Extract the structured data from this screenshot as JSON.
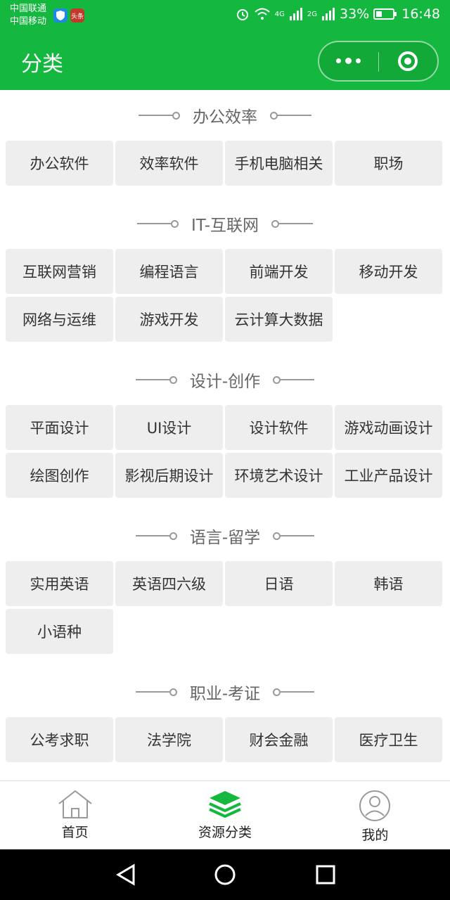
{
  "status_bar": {
    "carrier_1": "中国联通",
    "carrier_2": "中国移动",
    "app_badge": "头条",
    "network_1": "4G",
    "network_2": "2G",
    "battery": "33%",
    "time": "16:48"
  },
  "title_bar": {
    "title": "分类"
  },
  "sections": [
    {
      "title": "办公效率",
      "items": [
        "办公软件",
        "效率软件",
        "手机电脑相关",
        "职场"
      ]
    },
    {
      "title": "IT-互联网",
      "items": [
        "互联网营销",
        "编程语言",
        "前端开发",
        "移动开发",
        "网络与运维",
        "游戏开发",
        "云计算大数据"
      ]
    },
    {
      "title": "设计-创作",
      "items": [
        "平面设计",
        "UI设计",
        "设计软件",
        "游戏动画设计",
        "绘图创作",
        "影视后期设计",
        "环境艺术设计",
        "工业产品设计"
      ]
    },
    {
      "title": "语言-留学",
      "items": [
        "实用英语",
        "英语四六级",
        "日语",
        "韩语",
        "小语种"
      ]
    },
    {
      "title": "职业-考证",
      "items": [
        "公考求职",
        "法学院",
        "财会金融",
        "医疗卫生"
      ]
    }
  ],
  "tab_bar": {
    "home": "首页",
    "categories": "资源分类",
    "mine": "我的"
  },
  "colors": {
    "brand_green": "#14b83e",
    "cell_bg": "#eeeeee"
  }
}
